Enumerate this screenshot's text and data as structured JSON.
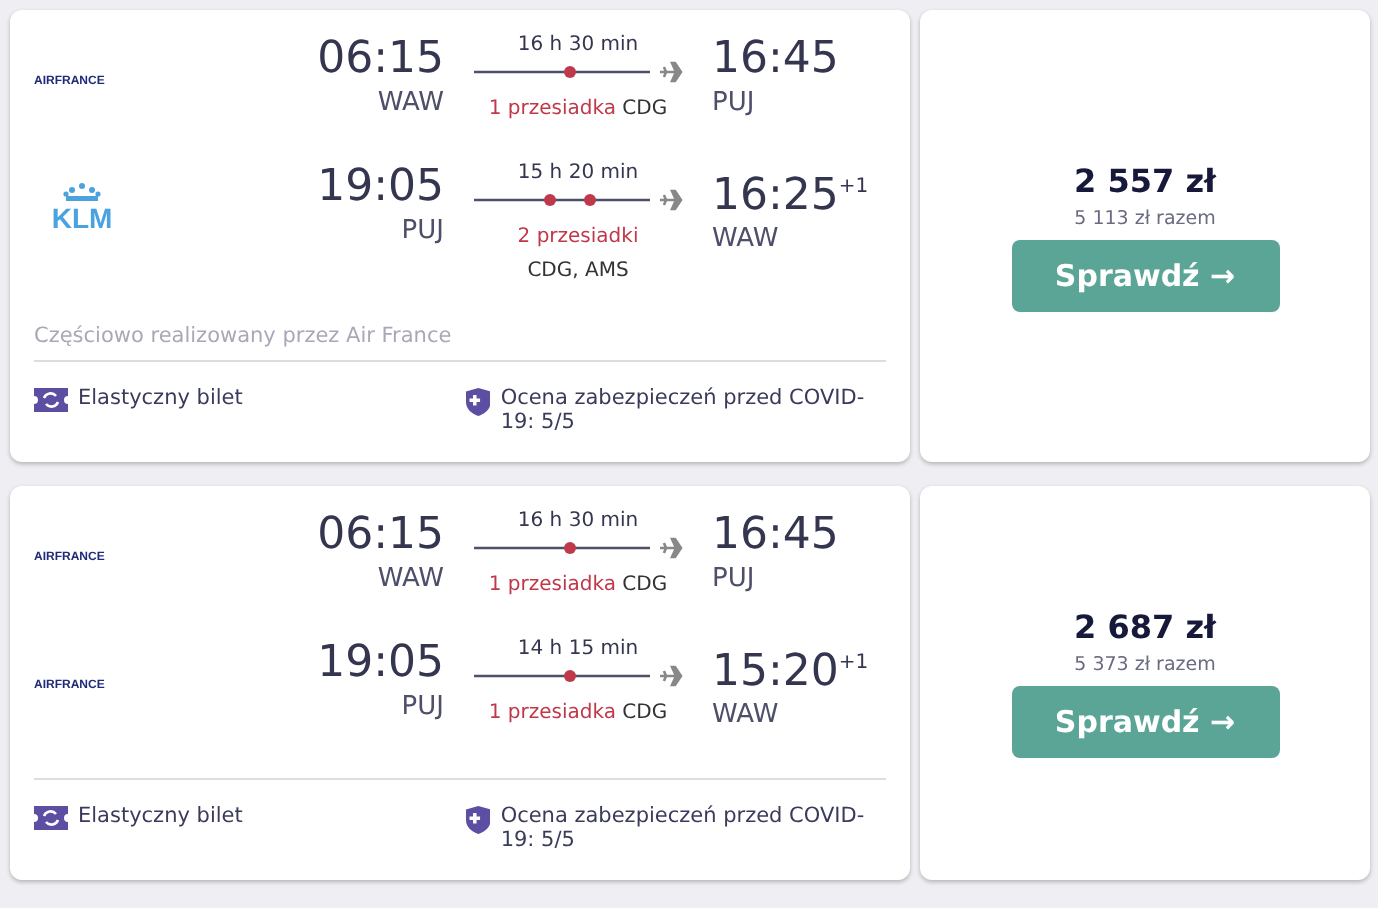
{
  "results": [
    {
      "legs": [
        {
          "airline_logo": {
            "kind": "airfrance",
            "text": "AIRFRANCE"
          },
          "depart_time": "06:15",
          "depart_airport": "WAW",
          "duration": "16 h 30 min",
          "stops": {
            "kind": "one_stop",
            "label": "1 przesiadka",
            "codes": "CDG"
          },
          "arrive_time": "16:45",
          "arrive_airport": "PUJ"
        },
        {
          "airline_logo": {
            "kind": "klm",
            "text": "KLM"
          },
          "depart_time": "19:05",
          "depart_airport": "PUJ",
          "duration": "15 h 20 min",
          "stops": {
            "kind": "two_stops",
            "label": "2 przesiadki",
            "codes": "CDG, AMS"
          },
          "arrive_time": "16:25",
          "day_offset": "+1",
          "arrive_airport": "WAW"
        }
      ],
      "operated_note": "Częściowo realizowany przez Air France",
      "features": [
        "Elastyczny bilet",
        "Ocena zabezpieczeń przed COVID-19: 5/5"
      ],
      "price": "2 557 zł",
      "total": "5 113 zł razem",
      "button": "Sprawdź →"
    },
    {
      "legs": [
        {
          "airline_logo": {
            "kind": "airfrance",
            "text": "AIRFRANCE"
          },
          "depart_time": "06:15",
          "depart_airport": "WAW",
          "duration": "16 h 30 min",
          "stops": {
            "kind": "one_stop",
            "label": "1 przesiadka",
            "codes": "CDG"
          },
          "arrive_time": "16:45",
          "arrive_airport": "PUJ"
        },
        {
          "airline_logo": {
            "kind": "airfrance",
            "text": "AIRFRANCE"
          },
          "depart_time": "19:05",
          "depart_airport": "PUJ",
          "duration": "14 h 15 min",
          "stops": {
            "kind": "one_stop",
            "label": "1 przesiadka",
            "codes": "CDG"
          },
          "arrive_time": "15:20",
          "day_offset": "+1",
          "arrive_airport": "WAW"
        }
      ],
      "features": [
        "Elastyczny bilet",
        "Ocena zabezpieczeń przed COVID-19: 5/5"
      ],
      "price": "2 687 zł",
      "total": "5 373 zł razem",
      "button": "Sprawdź →"
    }
  ]
}
